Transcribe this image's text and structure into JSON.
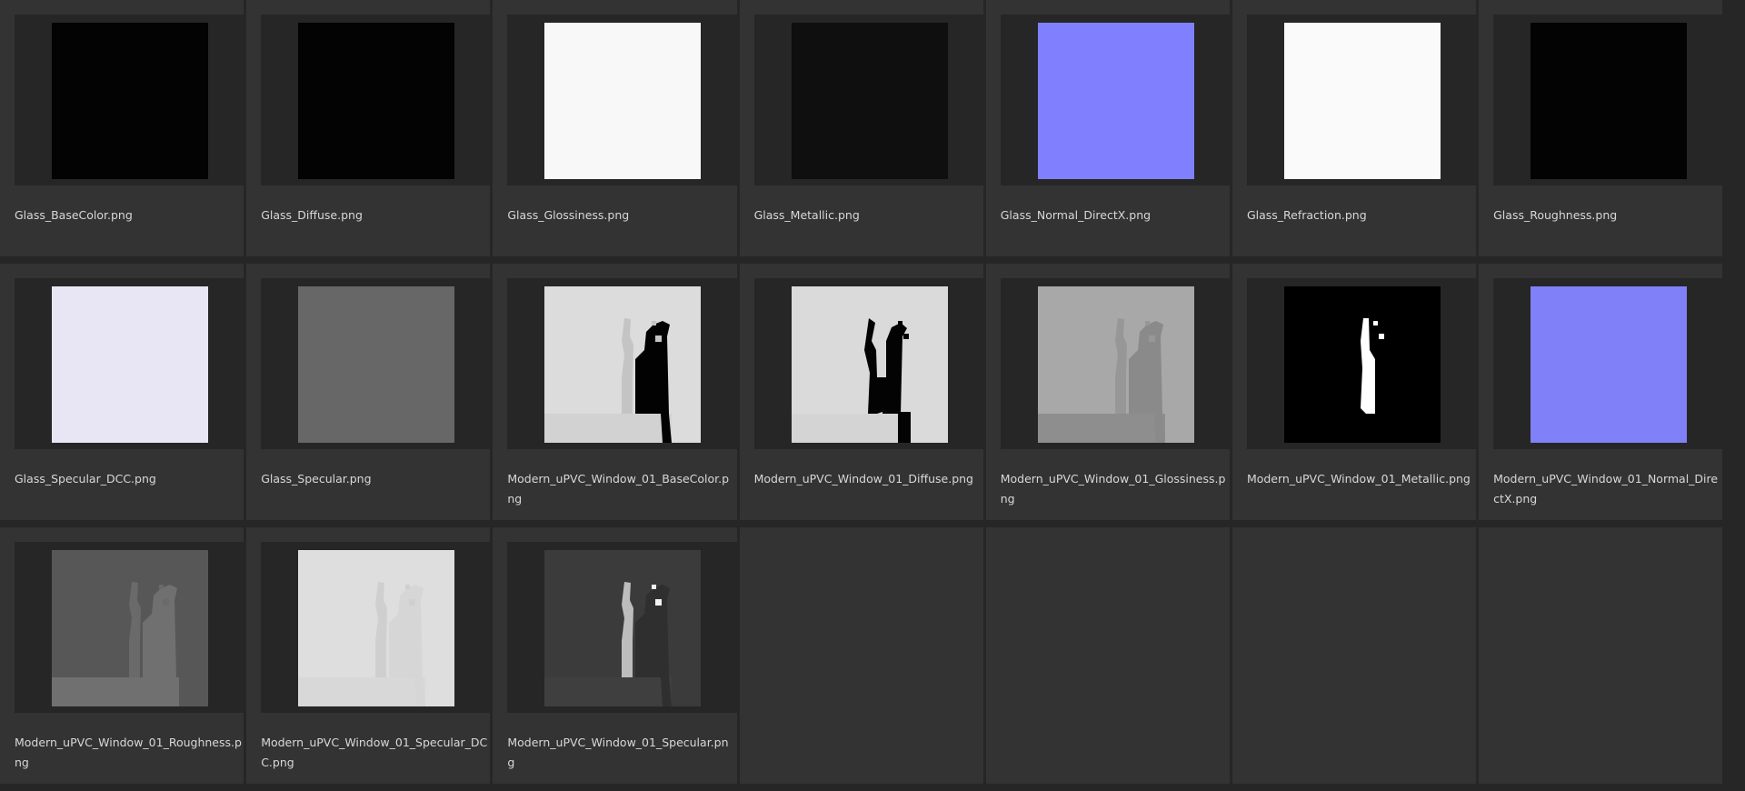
{
  "files": [
    {
      "name": "Glass_BaseColor.png",
      "thumb": "solid",
      "color": "#030303"
    },
    {
      "name": "Glass_Diffuse.png",
      "thumb": "solid",
      "color": "#030303"
    },
    {
      "name": "Glass_Glossiness.png",
      "thumb": "solid",
      "color": "#f8f8f8"
    },
    {
      "name": "Glass_Metallic.png",
      "thumb": "solid",
      "color": "#0f0f0f"
    },
    {
      "name": "Glass_Normal_DirectX.png",
      "thumb": "solid",
      "color": "#8080ff"
    },
    {
      "name": "Glass_Refraction.png",
      "thumb": "solid",
      "color": "#fafafa"
    },
    {
      "name": "Glass_Roughness.png",
      "thumb": "solid",
      "color": "#030303"
    },
    {
      "name": "Glass_Specular_DCC.png",
      "thumb": "solid",
      "color": "#e8e6f4"
    },
    {
      "name": "Glass_Specular.png",
      "thumb": "solid",
      "color": "#676767"
    },
    {
      "name": "Modern_uPVC_Window_01_BaseColor.png",
      "thumb": "window",
      "bg": "#dcdcdc",
      "frame": "#c4c4c4",
      "hole": "#020202",
      "base": "#d2d2d2"
    },
    {
      "name": "Modern_uPVC_Window_01_Diffuse.png",
      "thumb": "window",
      "bg": "#dadada",
      "frame": "#030303",
      "hole": "#030303",
      "base": "#d4d4d4",
      "diffuse": true
    },
    {
      "name": "Modern_uPVC_Window_01_Glossiness.png",
      "thumb": "window",
      "bg": "#a8a8a8",
      "frame": "#979797",
      "hole": "#8a8a8a",
      "base": "#8e8e8e"
    },
    {
      "name": "Modern_uPVC_Window_01_Metallic.png",
      "thumb": "metal",
      "bg": "#000000",
      "fg": "#ffffff"
    },
    {
      "name": "Modern_uPVC_Window_01_Normal_DirectX.png",
      "thumb": "solid",
      "color": "#8080f8"
    },
    {
      "name": "Modern_uPVC_Window_01_Roughness.png",
      "thumb": "window",
      "bg": "#575757",
      "frame": "#6a6a6a",
      "hole": "#707070",
      "base": "#707070"
    },
    {
      "name": "Modern_uPVC_Window_01_Specular_DCC.png",
      "thumb": "window",
      "bg": "#dedede",
      "frame": "#cfcfcf",
      "hole": "#d6d6d6",
      "base": "#d8d8d8"
    },
    {
      "name": "Modern_uPVC_Window_01_Specular.png",
      "thumb": "window",
      "bg": "#3b3b3b",
      "frame": "#bdbdbd",
      "hole": "#2f2f2f",
      "base": "#3f3f3f",
      "spec": true
    }
  ]
}
